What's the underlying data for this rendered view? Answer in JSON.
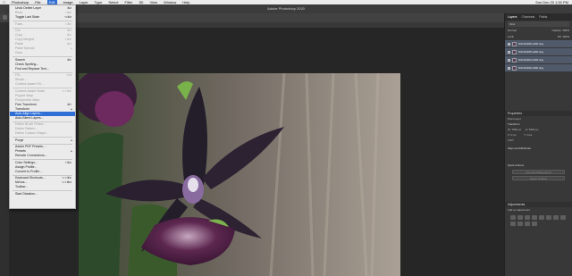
{
  "menubar": {
    "apple_icon": "apple-icon",
    "items": [
      "Photoshop",
      "File",
      "Edit",
      "Image",
      "Layer",
      "Type",
      "Select",
      "Filter",
      "3D",
      "View",
      "Window",
      "Help"
    ],
    "active_index": 2,
    "clock": "Sun Dec 20 1:30 PM"
  },
  "window": {
    "title": "Adobe Photoshop 2020"
  },
  "panels": {
    "tabs": [
      "Layers",
      "Channels",
      "Paths"
    ],
    "filter_label": "Kind",
    "blend_mode": "Normal",
    "opacity_label": "Opacity: 100%",
    "lock_label": "Lock:",
    "fill_label": "Fill: 100%",
    "layers": [
      "DSC02486-HDR.dng",
      "DSC02485-HDR.dng",
      "DSC02484-HDR.dng",
      "DSC02483-HDR.dng"
    ],
    "properties": {
      "title": "Properties",
      "kind": "Pixel Layer",
      "transform_title": "Transform",
      "w_label": "W: 7952 px",
      "h_label": "H: 5304 px",
      "x_label": "X: 0 px",
      "y_label": "Y: 0 px",
      "angle_label": "0.00°",
      "align_title": "Align and Distribute",
      "quick_actions_title": "Quick Actions",
      "btn_remove_bg": "Remove Background",
      "btn_select_subject": "Select Subject"
    },
    "adjustments": {
      "title": "Adjustments",
      "subtitle": "Add an adjustment"
    }
  },
  "edit_menu": {
    "items": [
      {
        "label": "Undo Delete Layer",
        "shortcut": "⌘Z",
        "enabled": true
      },
      {
        "label": "Redo",
        "shortcut": "⇧⌘Z",
        "enabled": false
      },
      {
        "label": "Toggle Last State",
        "shortcut": "⌥⌘Z",
        "enabled": true
      },
      {
        "sep": true
      },
      {
        "label": "Fade...",
        "shortcut": "⇧⌘F",
        "enabled": false
      },
      {
        "sep": true
      },
      {
        "label": "Cut",
        "shortcut": "⌘X",
        "enabled": false
      },
      {
        "label": "Copy",
        "shortcut": "⌘C",
        "enabled": false
      },
      {
        "label": "Copy Merged",
        "shortcut": "⇧⌘C",
        "enabled": false
      },
      {
        "label": "Paste",
        "shortcut": "⌘V",
        "enabled": false
      },
      {
        "label": "Paste Special",
        "arrow": true,
        "enabled": false
      },
      {
        "label": "Clear",
        "enabled": false
      },
      {
        "sep": true
      },
      {
        "label": "Search",
        "shortcut": "⌘F",
        "enabled": true
      },
      {
        "label": "Check Spelling...",
        "enabled": true
      },
      {
        "label": "Find and Replace Text...",
        "enabled": true
      },
      {
        "sep": true
      },
      {
        "label": "Fill...",
        "shortcut": "⇧F5",
        "enabled": false
      },
      {
        "label": "Stroke...",
        "enabled": false
      },
      {
        "label": "Content-Aware Fill...",
        "enabled": false
      },
      {
        "sep": true
      },
      {
        "label": "Content-Aware Scale",
        "shortcut": "⌥⇧⌘C",
        "enabled": false
      },
      {
        "label": "Puppet Warp",
        "enabled": false
      },
      {
        "label": "Perspective Warp",
        "enabled": false
      },
      {
        "label": "Free Transform",
        "shortcut": "⌘T",
        "enabled": true
      },
      {
        "label": "Transform",
        "arrow": true,
        "enabled": true
      },
      {
        "label": "Auto-Align Layers...",
        "enabled": true,
        "highlight": true
      },
      {
        "label": "Auto-Blend Layers...",
        "enabled": true
      },
      {
        "sep": true
      },
      {
        "label": "Define Brush Preset...",
        "enabled": false
      },
      {
        "label": "Define Pattern...",
        "enabled": false
      },
      {
        "label": "Define Custom Shape...",
        "enabled": false
      },
      {
        "sep": true
      },
      {
        "label": "Purge",
        "arrow": true,
        "enabled": true
      },
      {
        "sep": true
      },
      {
        "label": "Adobe PDF Presets...",
        "enabled": true
      },
      {
        "label": "Presets",
        "arrow": true,
        "enabled": true
      },
      {
        "label": "Remote Connections...",
        "enabled": true
      },
      {
        "sep": true
      },
      {
        "label": "Color Settings...",
        "shortcut": "⇧⌘K",
        "enabled": true
      },
      {
        "label": "Assign Profile...",
        "enabled": true
      },
      {
        "label": "Convert to Profile...",
        "enabled": true
      },
      {
        "sep": true
      },
      {
        "label": "Keyboard Shortcuts...",
        "shortcut": "⌥⇧⌘K",
        "enabled": true
      },
      {
        "label": "Menus...",
        "shortcut": "⌥⇧⌘M",
        "enabled": true
      },
      {
        "label": "Toolbar...",
        "enabled": true
      },
      {
        "sep": true
      },
      {
        "label": "Start Dictation...",
        "enabled": true
      }
    ]
  }
}
